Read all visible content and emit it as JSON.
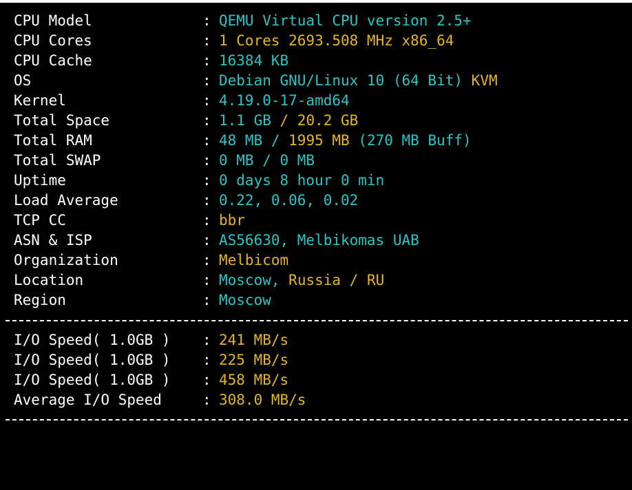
{
  "colors": {
    "background": "#000000",
    "label": "#ffffff",
    "cyan": "#2cc5c5",
    "yellow": "#e3b529"
  },
  "separator": ":",
  "system_info": {
    "cpu_model": {
      "label": "CPU Model",
      "value": "QEMU Virtual CPU version 2.5+"
    },
    "cpu_cores": {
      "label": "CPU Cores",
      "value": "1 Cores 2693.508 MHz x86_64"
    },
    "cpu_cache": {
      "label": "CPU Cache",
      "value": "16384 KB"
    },
    "os": {
      "label": "OS",
      "value": "Debian GNU/Linux 10 (64 Bit)",
      "virt": "KVM"
    },
    "kernel": {
      "label": "Kernel",
      "value": "4.19.0-17-amd64"
    },
    "total_space": {
      "label": "Total Space",
      "used": "1.1 GB",
      "sep": " / ",
      "total": "20.2 GB"
    },
    "total_ram": {
      "label": "Total RAM",
      "used": "48 MB",
      "sep": " / ",
      "total": "1995 MB",
      "buff": "(270 MB Buff)"
    },
    "total_swap": {
      "label": "Total SWAP",
      "value": "0 MB / 0 MB"
    },
    "uptime": {
      "label": "Uptime",
      "value": "0 days 8 hour 0 min"
    },
    "load_average": {
      "label": "Load Average",
      "value": "0.22, 0.06, 0.02"
    },
    "tcp_cc": {
      "label": "TCP CC",
      "value": "bbr"
    },
    "asn_isp": {
      "label": "ASN & ISP",
      "value": "AS56630, Melbikomas UAB"
    },
    "organization": {
      "label": "Organization",
      "value": "Melbicom"
    },
    "location": {
      "label": "Location",
      "city": "Moscow,",
      "country": "Russia / RU"
    },
    "region": {
      "label": "Region",
      "value": "Moscow"
    }
  },
  "io_tests": [
    {
      "label": "I/O Speed( 1.0GB )",
      "value": "241 MB/s"
    },
    {
      "label": "I/O Speed( 1.0GB )",
      "value": "225 MB/s"
    },
    {
      "label": "I/O Speed( 1.0GB )",
      "value": "458 MB/s"
    }
  ],
  "io_average": {
    "label": "Average I/O Speed",
    "value": "308.0 MB/s"
  }
}
